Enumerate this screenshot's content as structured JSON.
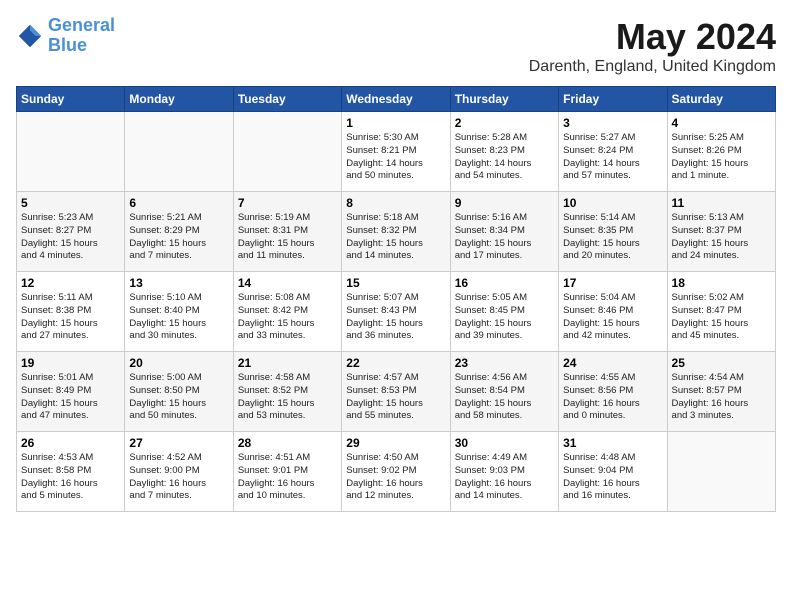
{
  "header": {
    "logo_line1": "General",
    "logo_line2": "Blue",
    "month": "May 2024",
    "location": "Darenth, England, United Kingdom"
  },
  "days_of_week": [
    "Sunday",
    "Monday",
    "Tuesday",
    "Wednesday",
    "Thursday",
    "Friday",
    "Saturday"
  ],
  "weeks": [
    [
      {
        "day": "",
        "info": ""
      },
      {
        "day": "",
        "info": ""
      },
      {
        "day": "",
        "info": ""
      },
      {
        "day": "1",
        "info": "Sunrise: 5:30 AM\nSunset: 8:21 PM\nDaylight: 14 hours\nand 50 minutes."
      },
      {
        "day": "2",
        "info": "Sunrise: 5:28 AM\nSunset: 8:23 PM\nDaylight: 14 hours\nand 54 minutes."
      },
      {
        "day": "3",
        "info": "Sunrise: 5:27 AM\nSunset: 8:24 PM\nDaylight: 14 hours\nand 57 minutes."
      },
      {
        "day": "4",
        "info": "Sunrise: 5:25 AM\nSunset: 8:26 PM\nDaylight: 15 hours\nand 1 minute."
      }
    ],
    [
      {
        "day": "5",
        "info": "Sunrise: 5:23 AM\nSunset: 8:27 PM\nDaylight: 15 hours\nand 4 minutes."
      },
      {
        "day": "6",
        "info": "Sunrise: 5:21 AM\nSunset: 8:29 PM\nDaylight: 15 hours\nand 7 minutes."
      },
      {
        "day": "7",
        "info": "Sunrise: 5:19 AM\nSunset: 8:31 PM\nDaylight: 15 hours\nand 11 minutes."
      },
      {
        "day": "8",
        "info": "Sunrise: 5:18 AM\nSunset: 8:32 PM\nDaylight: 15 hours\nand 14 minutes."
      },
      {
        "day": "9",
        "info": "Sunrise: 5:16 AM\nSunset: 8:34 PM\nDaylight: 15 hours\nand 17 minutes."
      },
      {
        "day": "10",
        "info": "Sunrise: 5:14 AM\nSunset: 8:35 PM\nDaylight: 15 hours\nand 20 minutes."
      },
      {
        "day": "11",
        "info": "Sunrise: 5:13 AM\nSunset: 8:37 PM\nDaylight: 15 hours\nand 24 minutes."
      }
    ],
    [
      {
        "day": "12",
        "info": "Sunrise: 5:11 AM\nSunset: 8:38 PM\nDaylight: 15 hours\nand 27 minutes."
      },
      {
        "day": "13",
        "info": "Sunrise: 5:10 AM\nSunset: 8:40 PM\nDaylight: 15 hours\nand 30 minutes."
      },
      {
        "day": "14",
        "info": "Sunrise: 5:08 AM\nSunset: 8:42 PM\nDaylight: 15 hours\nand 33 minutes."
      },
      {
        "day": "15",
        "info": "Sunrise: 5:07 AM\nSunset: 8:43 PM\nDaylight: 15 hours\nand 36 minutes."
      },
      {
        "day": "16",
        "info": "Sunrise: 5:05 AM\nSunset: 8:45 PM\nDaylight: 15 hours\nand 39 minutes."
      },
      {
        "day": "17",
        "info": "Sunrise: 5:04 AM\nSunset: 8:46 PM\nDaylight: 15 hours\nand 42 minutes."
      },
      {
        "day": "18",
        "info": "Sunrise: 5:02 AM\nSunset: 8:47 PM\nDaylight: 15 hours\nand 45 minutes."
      }
    ],
    [
      {
        "day": "19",
        "info": "Sunrise: 5:01 AM\nSunset: 8:49 PM\nDaylight: 15 hours\nand 47 minutes."
      },
      {
        "day": "20",
        "info": "Sunrise: 5:00 AM\nSunset: 8:50 PM\nDaylight: 15 hours\nand 50 minutes."
      },
      {
        "day": "21",
        "info": "Sunrise: 4:58 AM\nSunset: 8:52 PM\nDaylight: 15 hours\nand 53 minutes."
      },
      {
        "day": "22",
        "info": "Sunrise: 4:57 AM\nSunset: 8:53 PM\nDaylight: 15 hours\nand 55 minutes."
      },
      {
        "day": "23",
        "info": "Sunrise: 4:56 AM\nSunset: 8:54 PM\nDaylight: 15 hours\nand 58 minutes."
      },
      {
        "day": "24",
        "info": "Sunrise: 4:55 AM\nSunset: 8:56 PM\nDaylight: 16 hours\nand 0 minutes."
      },
      {
        "day": "25",
        "info": "Sunrise: 4:54 AM\nSunset: 8:57 PM\nDaylight: 16 hours\nand 3 minutes."
      }
    ],
    [
      {
        "day": "26",
        "info": "Sunrise: 4:53 AM\nSunset: 8:58 PM\nDaylight: 16 hours\nand 5 minutes."
      },
      {
        "day": "27",
        "info": "Sunrise: 4:52 AM\nSunset: 9:00 PM\nDaylight: 16 hours\nand 7 minutes."
      },
      {
        "day": "28",
        "info": "Sunrise: 4:51 AM\nSunset: 9:01 PM\nDaylight: 16 hours\nand 10 minutes."
      },
      {
        "day": "29",
        "info": "Sunrise: 4:50 AM\nSunset: 9:02 PM\nDaylight: 16 hours\nand 12 minutes."
      },
      {
        "day": "30",
        "info": "Sunrise: 4:49 AM\nSunset: 9:03 PM\nDaylight: 16 hours\nand 14 minutes."
      },
      {
        "day": "31",
        "info": "Sunrise: 4:48 AM\nSunset: 9:04 PM\nDaylight: 16 hours\nand 16 minutes."
      },
      {
        "day": "",
        "info": ""
      }
    ]
  ]
}
